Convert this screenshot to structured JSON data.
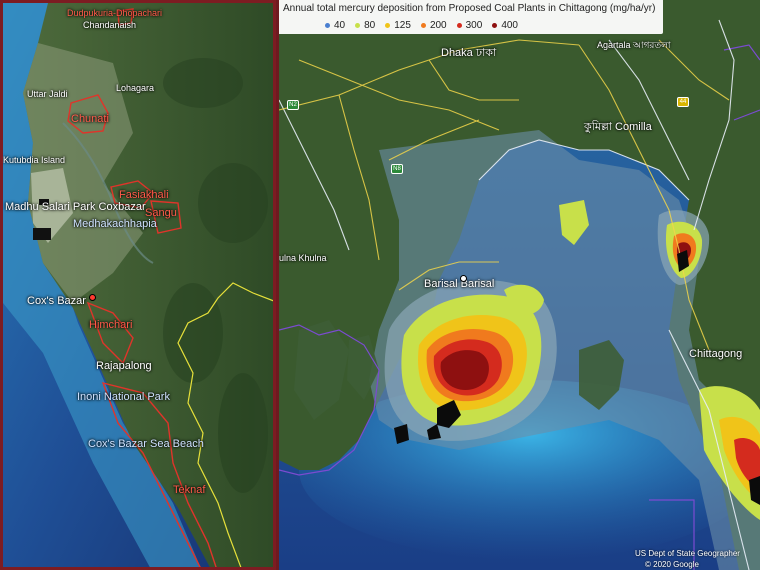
{
  "left_map": {
    "places": [
      {
        "name": "Dudpukuria-Dhopachari",
        "kind": "red"
      },
      {
        "name": "Chandanaish",
        "kind": "white"
      },
      {
        "name": "Uttar Jaldi",
        "kind": "white"
      },
      {
        "name": "Lohagara",
        "kind": "white"
      },
      {
        "name": "Chunati",
        "kind": "red"
      },
      {
        "name": "Kutubdia Island",
        "kind": "white"
      },
      {
        "name": "Fasiakhali",
        "kind": "red"
      },
      {
        "name": "Madhu Salari Park Coxbazar",
        "kind": "white"
      },
      {
        "name": "Sangu",
        "kind": "red"
      },
      {
        "name": "Medhakachhapia",
        "kind": "blue"
      },
      {
        "name": "Cox's Bazar",
        "kind": "white"
      },
      {
        "name": "Himchari",
        "kind": "red"
      },
      {
        "name": "Rajapalong",
        "kind": "white"
      },
      {
        "name": "Inoni National Park",
        "kind": "blue"
      },
      {
        "name": "Cox's Bazar Sea Beach",
        "kind": "blue"
      },
      {
        "name": "Teknaf",
        "kind": "red"
      }
    ]
  },
  "right_map": {
    "legend": {
      "title": "Annual total mercury deposition from Proposed Coal Plants in Chittagong (mg/ha/yr)",
      "items": [
        {
          "label": "40",
          "color": "#4a7fd0"
        },
        {
          "label": "80",
          "color": "#c8e04a"
        },
        {
          "label": "125",
          "color": "#f0c419"
        },
        {
          "label": "200",
          "color": "#f07a1e"
        },
        {
          "label": "300",
          "color": "#d42b1e"
        },
        {
          "label": "400",
          "color": "#8e1010"
        }
      ]
    },
    "places": {
      "dhaka": "Dhaka ঢাকা",
      "agartala": "Agartala আগরতলা",
      "comilla": "কুমিল্লা Comilla",
      "khulna": "ulna Khulna",
      "barisal": "Barisal Barisal",
      "chittagong": "Chittagong"
    },
    "road_shields": [
      "N2",
      "N8",
      "44"
    ],
    "attribution": [
      "US Dept of State Geographer",
      "© 2020 Google"
    ]
  }
}
